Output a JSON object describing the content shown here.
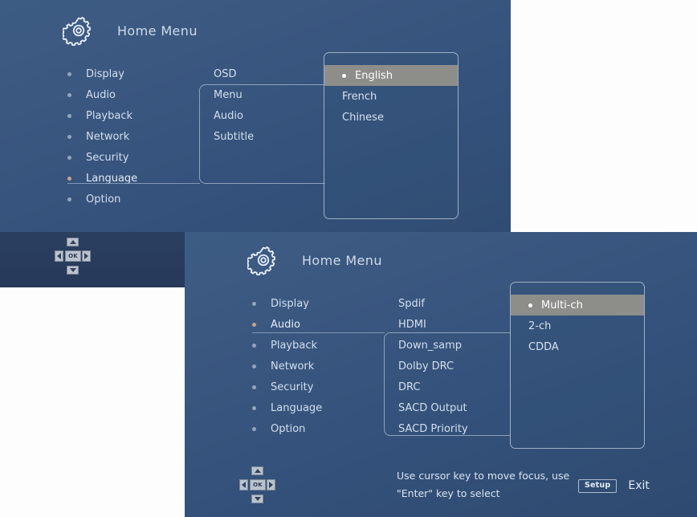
{
  "meta": {
    "accent_bullet": "#93a6bf",
    "accent_active_bullet": "#c4a58c",
    "highlight_bg": "#8d8d8a",
    "panel_border": "#9db0c8",
    "bg_top": "#3d5c83",
    "bg_bottom": "#2f4a70"
  },
  "window1": {
    "header": {
      "title": "Home Menu",
      "icon": "gear-icon"
    },
    "categories": [
      {
        "label": "Display",
        "active": false
      },
      {
        "label": "Audio",
        "active": false
      },
      {
        "label": "Playback",
        "active": false
      },
      {
        "label": "Network",
        "active": false
      },
      {
        "label": "Security",
        "active": false
      },
      {
        "label": "Language",
        "active": true
      },
      {
        "label": "Option",
        "active": false
      }
    ],
    "submenu": [
      {
        "label": "OSD"
      },
      {
        "label": "Menu"
      },
      {
        "label": "Audio"
      },
      {
        "label": "Subtitle"
      }
    ],
    "options": [
      {
        "label": "English",
        "selected": true
      },
      {
        "label": "French",
        "selected": false
      },
      {
        "label": "Chinese",
        "selected": false
      }
    ],
    "dpad": {
      "ok_label": "OK",
      "up": "up-arrow",
      "down": "down-arrow",
      "left": "left-arrow",
      "right": "right-arrow"
    }
  },
  "window2": {
    "header": {
      "title": "Home Menu",
      "icon": "gear-icon"
    },
    "categories": [
      {
        "label": "Display",
        "active": false
      },
      {
        "label": "Audio",
        "active": true
      },
      {
        "label": "Playback",
        "active": false
      },
      {
        "label": "Network",
        "active": false
      },
      {
        "label": "Security",
        "active": false
      },
      {
        "label": "Language",
        "active": false
      },
      {
        "label": "Option",
        "active": false
      }
    ],
    "submenu": [
      {
        "label": "Spdif"
      },
      {
        "label": "HDMI"
      },
      {
        "label": "Down_samp"
      },
      {
        "label": "Dolby DRC"
      },
      {
        "label": "DRC"
      },
      {
        "label": "SACD Output"
      },
      {
        "label": "SACD Priority"
      }
    ],
    "options": [
      {
        "label": "Multi-ch",
        "selected": true
      },
      {
        "label": "2-ch",
        "selected": false
      },
      {
        "label": "CDDA",
        "selected": false
      }
    ],
    "dpad": {
      "ok_label": "OK",
      "up": "up-arrow",
      "down": "down-arrow",
      "left": "left-arrow",
      "right": "right-arrow"
    },
    "hint_line1": "Use cursor key to move focus, use",
    "hint_line2": "\"Enter\" key to select",
    "setup_label": "Setup",
    "exit_label": "Exit"
  }
}
